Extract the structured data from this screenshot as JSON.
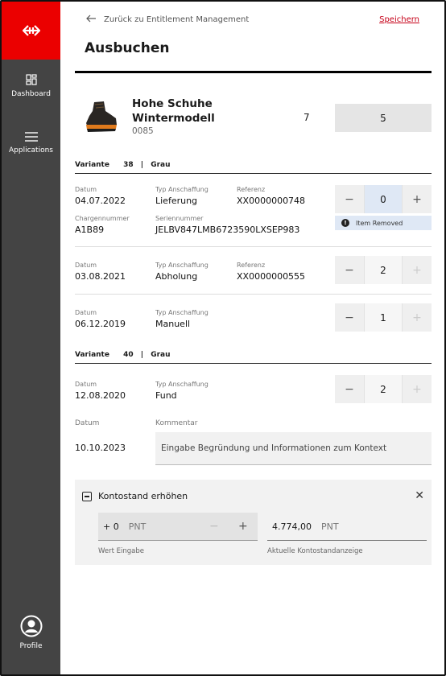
{
  "sidebar": {
    "items": [
      {
        "label": "Dashboard",
        "icon": "dashboard-icon"
      },
      {
        "label": "Applications",
        "icon": "menu-icon"
      }
    ],
    "profile": {
      "label": "Profile",
      "icon": "user-icon"
    },
    "brand_color": "#eb0000"
  },
  "header": {
    "back_label": "Zurück zu Entitlement Management",
    "save_label": "Speichern",
    "title": "Ausbuchen"
  },
  "product": {
    "name": "Hohe Schuhe Wintermodell",
    "code": "0085",
    "stock": "7",
    "quantity": "5"
  },
  "variants": [
    {
      "label": "Variante",
      "size": "38",
      "sep": "|",
      "color": "Grau",
      "entries": [
        {
          "date_label": "Datum",
          "date": "04.07.2022",
          "type_label": "Typ Anschaffung",
          "type": "Lieferung",
          "ref_label": "Referenz",
          "ref": "XX0000000748",
          "batch_label": "Chargennummer",
          "batch": "A1B89",
          "serial_label": "Seriennummer",
          "serial": "JELBV847LMB6723590LXSEP983",
          "qty": "0",
          "status": "Item Removed",
          "status_icon": "info-icon"
        },
        {
          "date_label": "Datum",
          "date": "03.08.2021",
          "type_label": "Typ Anschaffung",
          "type": "Abholung",
          "ref_label": "Referenz",
          "ref": "XX0000000555",
          "qty": "2"
        },
        {
          "date_label": "Datum",
          "date": "06.12.2019",
          "type_label": "Typ Anschaffung",
          "type": "Manuell",
          "qty": "1"
        }
      ]
    },
    {
      "label": "Variante",
      "size": "40",
      "sep": "|",
      "color": "Grau",
      "entries": [
        {
          "date_label": "Datum",
          "date": "12.08.2020",
          "type_label": "Typ Anschaffung",
          "type": "Fund",
          "qty": "2"
        }
      ]
    }
  ],
  "comment": {
    "date_label": "Datum",
    "date": "10.10.2023",
    "label": "Kommentar",
    "placeholder": "Eingabe Begründung und Informationen zum Kontext"
  },
  "account": {
    "title": "Kontostand erhöhen",
    "input_value": "+ 0",
    "input_unit": "PNT",
    "input_hint": "Wert Eingabe",
    "balance_value": "4.774,00",
    "balance_unit": "PNT",
    "balance_hint": "Aktuelle Kontostandanzeige"
  },
  "stepper": {
    "minus": "−",
    "plus": "+"
  }
}
